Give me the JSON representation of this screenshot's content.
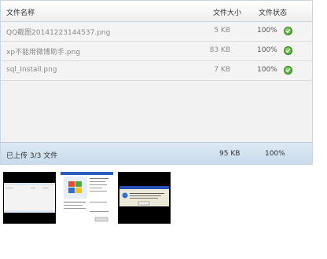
{
  "header": {
    "name": "文件名称",
    "size": "文件大小",
    "status": "文件状态"
  },
  "files": [
    {
      "name": "QQ截图20141223144537.png",
      "size": "5 KB",
      "percent": "100%"
    },
    {
      "name": "xp不能用微博助手.png",
      "size": "83 KB",
      "percent": "100%"
    },
    {
      "name": "sql_Install.png",
      "size": "7 KB",
      "percent": "100%"
    }
  ],
  "footer": {
    "summary": "已上传 3/3 文件",
    "total": "95 KB",
    "percent": "100%"
  },
  "colors": {
    "border": "#c8d6e2",
    "footer": "#c9dbec",
    "ok": "#3a9a1e"
  },
  "thumbnail_icons": [
    "screenshot-thumbnail",
    "dialog-thumbnail",
    "dialog-thumbnail"
  ]
}
